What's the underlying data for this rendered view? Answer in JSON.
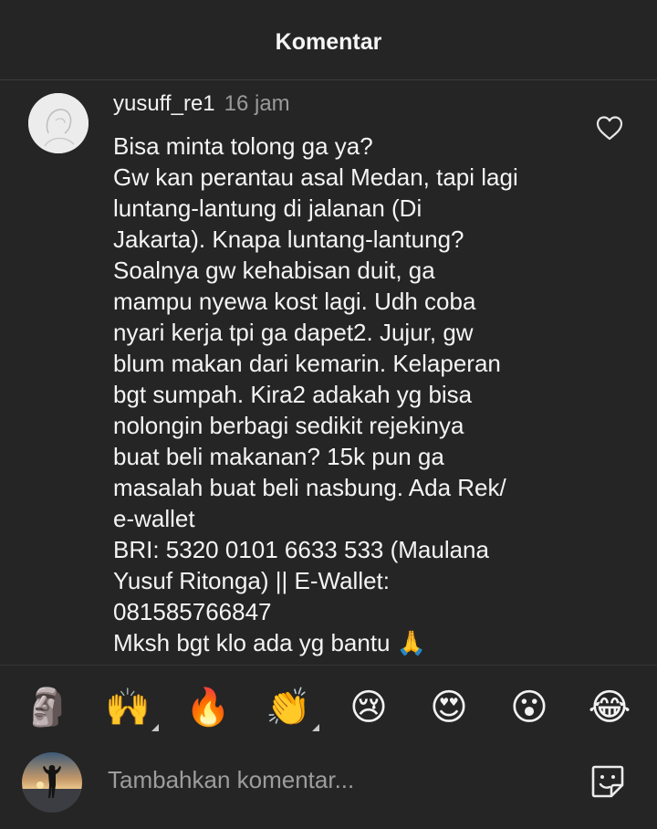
{
  "header": {
    "title": "Komentar"
  },
  "comment": {
    "username": "yusuff_re1",
    "time": "16 jam",
    "lines": [
      "Bisa minta tolong ga ya?",
      "Gw kan perantau asal Medan, tapi lagi",
      "luntang-lantung di jalanan (Di",
      "Jakarta). Knapa luntang-lantung?",
      "Soalnya gw kehabisan duit, ga",
      "mampu nyewa kost lagi. Udh coba",
      "nyari kerja tpi ga dapet2. Jujur, gw",
      "blum makan dari kemarin. Kelaperan",
      "bgt sumpah. Kira2 adakah yg bisa",
      "nolongin berbagi sedikit rejekinya",
      "buat beli makanan? 15k pun ga",
      "masalah buat beli nasbung. Ada Rek/",
      "e-wallet",
      "BRI: 5320 0101 6633 533 (Maulana",
      "Yusuf Ritonga) || E-Wallet:",
      "081585766847",
      "Mksh bgt klo ada yg bantu 🙏"
    ],
    "like_icon": "heart-outline-icon"
  },
  "emoji_bar": [
    {
      "name": "moai",
      "glyph": "🗿"
    },
    {
      "name": "raising-hands",
      "glyph": "🙌"
    },
    {
      "name": "fire",
      "glyph": "🔥"
    },
    {
      "name": "clapping-hands",
      "glyph": "👏"
    },
    {
      "name": "crying-face",
      "glyph": "😢"
    },
    {
      "name": "heart-eyes",
      "glyph": "😍"
    },
    {
      "name": "surprised-face",
      "glyph": "😮"
    },
    {
      "name": "tears-of-joy",
      "glyph": "😂"
    }
  ],
  "composer": {
    "placeholder": "Tambahkan komentar...",
    "sticker_icon": "sticker-icon"
  }
}
